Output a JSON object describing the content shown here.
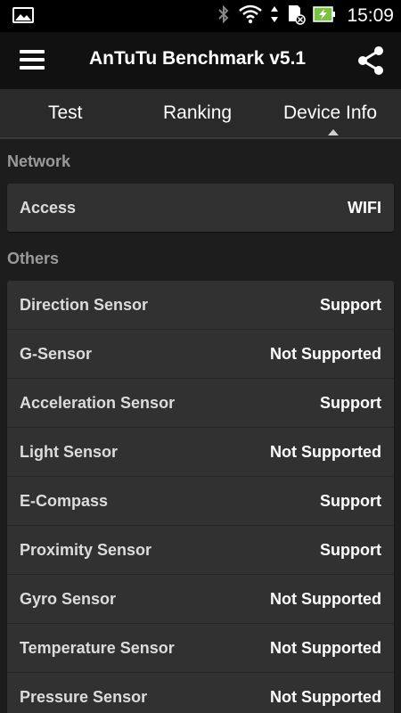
{
  "status_bar": {
    "time": "15:09",
    "icons": [
      "image-icon",
      "bluetooth-icon",
      "wifi-icon",
      "data-transfer-icon",
      "sd-card-icon",
      "battery-charging-icon"
    ]
  },
  "app_bar": {
    "title": "AnTuTu Benchmark v5.1",
    "menu_icon": "menu-icon",
    "share_icon": "share-icon"
  },
  "tabs": [
    {
      "label": "Test"
    },
    {
      "label": "Ranking"
    },
    {
      "label": "Device Info",
      "selected": true
    }
  ],
  "sections": {
    "network": {
      "title": "Network",
      "rows": [
        {
          "label": "Access",
          "value": "WIFI"
        }
      ]
    },
    "others": {
      "title": "Others",
      "rows": [
        {
          "label": "Direction Sensor",
          "value": "Support"
        },
        {
          "label": "G-Sensor",
          "value": "Not Supported"
        },
        {
          "label": "Acceleration Sensor",
          "value": "Support"
        },
        {
          "label": "Light Sensor",
          "value": "Not Supported"
        },
        {
          "label": "E-Compass",
          "value": "Support"
        },
        {
          "label": "Proximity Sensor",
          "value": "Support"
        },
        {
          "label": "Gyro Sensor",
          "value": "Not Supported"
        },
        {
          "label": "Temperature Sensor",
          "value": "Not Supported"
        },
        {
          "label": "Pressure Sensor",
          "value": "Not Supported"
        }
      ]
    }
  },
  "colors": {
    "status_bar": "#000000",
    "app_bar": "#111111",
    "tab_bar": "#2a2a2a",
    "card": "#313131",
    "section_header": "#9a9a9a",
    "battery_accent": "#7cc242"
  }
}
